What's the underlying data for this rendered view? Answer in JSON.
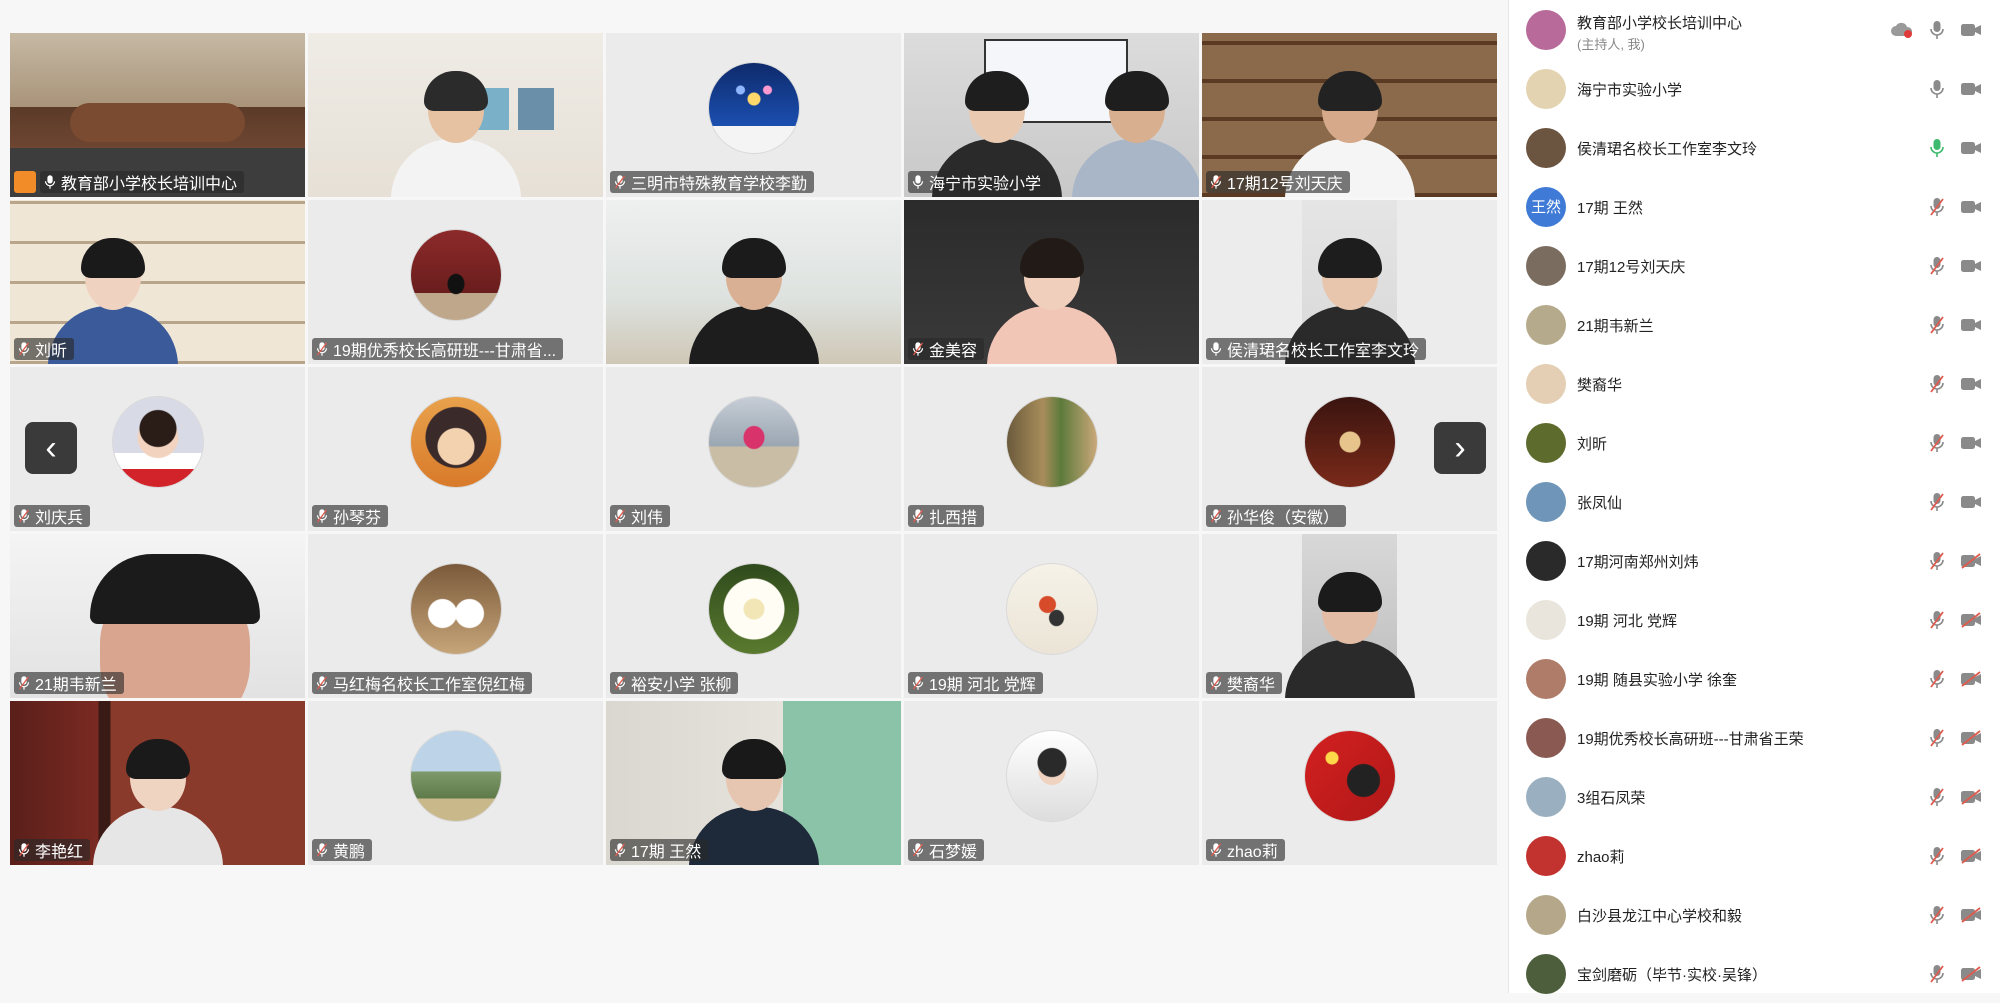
{
  "grid": {
    "tiles": [
      {
        "name": "教育部小学校长培训中心",
        "host": true,
        "mic": "on",
        "kind": "video",
        "scene": "conference-room"
      },
      {
        "name": "",
        "mic": "none",
        "kind": "video",
        "scene": "living-room-man"
      },
      {
        "name": "三明市特殊教育学校李勤",
        "mic": "muted",
        "kind": "avatar",
        "avatar": "fireworks"
      },
      {
        "name": "海宁市实验小学",
        "mic": "on",
        "kind": "video",
        "scene": "two-people"
      },
      {
        "name": "17期12号刘天庆",
        "mic": "muted",
        "kind": "video",
        "scene": "bookshelf-man"
      },
      {
        "name": "刘昕",
        "mic": "muted",
        "kind": "video",
        "scene": "shelf-woman"
      },
      {
        "name": "19期优秀校长高研班---甘肃省...",
        "mic": "muted",
        "kind": "avatar",
        "avatar": "stage"
      },
      {
        "name": "",
        "mic": "none",
        "kind": "video",
        "scene": "bright-room-man"
      },
      {
        "name": "金美容",
        "mic": "muted",
        "kind": "video",
        "scene": "cabinet-woman"
      },
      {
        "name": "侯清珺名校长工作室李文玲",
        "mic": "on",
        "kind": "video",
        "scene": "door-woman",
        "active": true
      },
      {
        "name": "刘庆兵",
        "mic": "muted",
        "kind": "avatar",
        "avatar": "student"
      },
      {
        "name": "孙琴芬",
        "mic": "muted",
        "kind": "avatar",
        "avatar": "anime"
      },
      {
        "name": "刘伟",
        "mic": "muted",
        "kind": "avatar",
        "avatar": "beach"
      },
      {
        "name": "扎西措",
        "mic": "muted",
        "kind": "avatar",
        "avatar": "street"
      },
      {
        "name": "孙华俊（安徽）",
        "mic": "muted",
        "kind": "avatar",
        "avatar": "red-room"
      },
      {
        "name": "21期韦新兰",
        "mic": "muted",
        "kind": "video",
        "scene": "closeup-woman"
      },
      {
        "name": "马红梅名校长工作室倪红梅",
        "mic": "muted",
        "kind": "avatar",
        "avatar": "vases"
      },
      {
        "name": "裕安小学 张柳",
        "mic": "muted",
        "kind": "avatar",
        "avatar": "flower"
      },
      {
        "name": "19期 河北 党辉",
        "mic": "muted",
        "kind": "avatar",
        "avatar": "fish"
      },
      {
        "name": "樊裔华",
        "mic": "muted",
        "kind": "video",
        "scene": "portrait-woman"
      },
      {
        "name": "李艳红",
        "mic": "muted",
        "kind": "video",
        "scene": "office-woman"
      },
      {
        "name": "黄鹏",
        "mic": "muted",
        "kind": "avatar",
        "avatar": "landscape"
      },
      {
        "name": "17期 王然",
        "mic": "muted",
        "kind": "video",
        "scene": "classroom-woman"
      },
      {
        "name": "石梦媛",
        "mic": "muted",
        "kind": "avatar",
        "avatar": "sketch"
      },
      {
        "name": "zhao莉",
        "mic": "muted",
        "kind": "avatar",
        "avatar": "flag"
      }
    ],
    "prev_label": "‹",
    "next_label": "›"
  },
  "panel": {
    "participants": [
      {
        "name": "教育部小学校长培训中心",
        "sub": "(主持人, 我)",
        "mic": "on",
        "cam": "on",
        "cloud": true,
        "avatar_color": "#b86a9a"
      },
      {
        "name": "海宁市实验小学",
        "mic": "on",
        "cam": "on",
        "avatar_color": "#e3d3b0"
      },
      {
        "name": "侯清珺名校长工作室李文玲",
        "mic": "speaking",
        "cam": "on",
        "avatar_color": "#6b5440"
      },
      {
        "name": "17期 王然",
        "mic": "muted",
        "cam": "on",
        "avatar_text": "王然",
        "avatar_color": "#3f7ad6"
      },
      {
        "name": "17期12号刘天庆",
        "mic": "muted",
        "cam": "on",
        "avatar_color": "#7a6c5e"
      },
      {
        "name": "21期韦新兰",
        "mic": "muted",
        "cam": "on",
        "avatar_color": "#b5ab8c"
      },
      {
        "name": "樊裔华",
        "mic": "muted",
        "cam": "on",
        "avatar_color": "#e5cfb4"
      },
      {
        "name": "刘昕",
        "mic": "muted",
        "cam": "on",
        "avatar_color": "#5d6b2d"
      },
      {
        "name": "张凤仙",
        "mic": "muted",
        "cam": "on",
        "avatar_color": "#6f95b8"
      },
      {
        "name": "17期河南郑州刘炜",
        "mic": "muted",
        "cam": "off",
        "avatar_color": "#2a2a2a"
      },
      {
        "name": "19期 河北 党辉",
        "mic": "muted",
        "cam": "off",
        "avatar_color": "#e9e4dc"
      },
      {
        "name": "19期 随县实验小学 徐奎",
        "mic": "muted",
        "cam": "off",
        "avatar_color": "#b07c6a"
      },
      {
        "name": "19期优秀校长高研班---甘肃省王荣",
        "mic": "muted",
        "cam": "off",
        "avatar_color": "#8a5a52"
      },
      {
        "name": "3组石凤荣",
        "mic": "muted",
        "cam": "off",
        "avatar_color": "#9ab0c0"
      },
      {
        "name": "zhao莉",
        "mic": "muted",
        "cam": "off",
        "avatar_color": "#c2322e"
      },
      {
        "name": "白沙县龙江中心学校和毅",
        "mic": "muted",
        "cam": "off",
        "avatar_color": "#b5a88a"
      },
      {
        "name": "宝剑磨砺（毕节·实校·吴锋）",
        "mic": "muted",
        "cam": "off",
        "avatar_color": "#4c5e3c"
      }
    ]
  }
}
